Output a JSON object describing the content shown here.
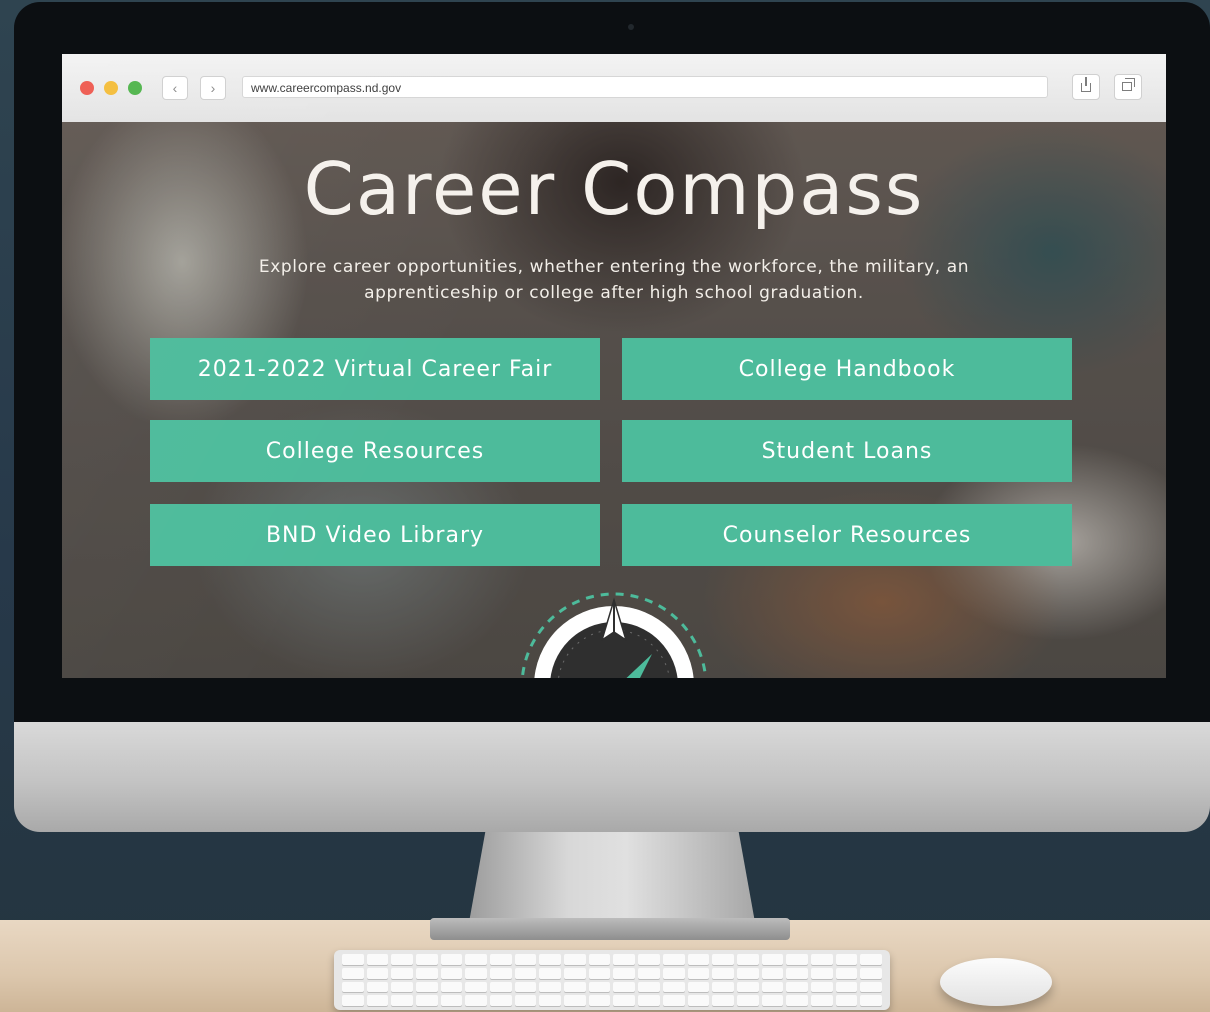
{
  "browser": {
    "url": "www.careercompass.nd.gov",
    "back_glyph": "‹",
    "forward_glyph": "›"
  },
  "hero": {
    "title": "Career Compass",
    "subtitle": "Explore career opportunities, whether entering the workforce, the military, an apprenticeship or college after high school graduation."
  },
  "buttons": [
    {
      "label": "2021-2022 Virtual Career Fair"
    },
    {
      "label": "College Handbook"
    },
    {
      "label": "College Resources"
    },
    {
      "label": "Student Loans"
    },
    {
      "label": "BND Video Library"
    },
    {
      "label": "Counselor Resources"
    }
  ],
  "icons": {
    "traffic_lights": [
      "close-light",
      "minimize-light",
      "zoom-light"
    ],
    "toolbar": [
      "share-icon",
      "tabs-icon"
    ],
    "logo": "compass-icon"
  },
  "colors": {
    "button": "#4dbb9b",
    "compass_needle": "#4dbb9b",
    "traffic_red": "#ee5a50",
    "traffic_yellow": "#f4bd3a",
    "traffic_green": "#50b54c"
  }
}
